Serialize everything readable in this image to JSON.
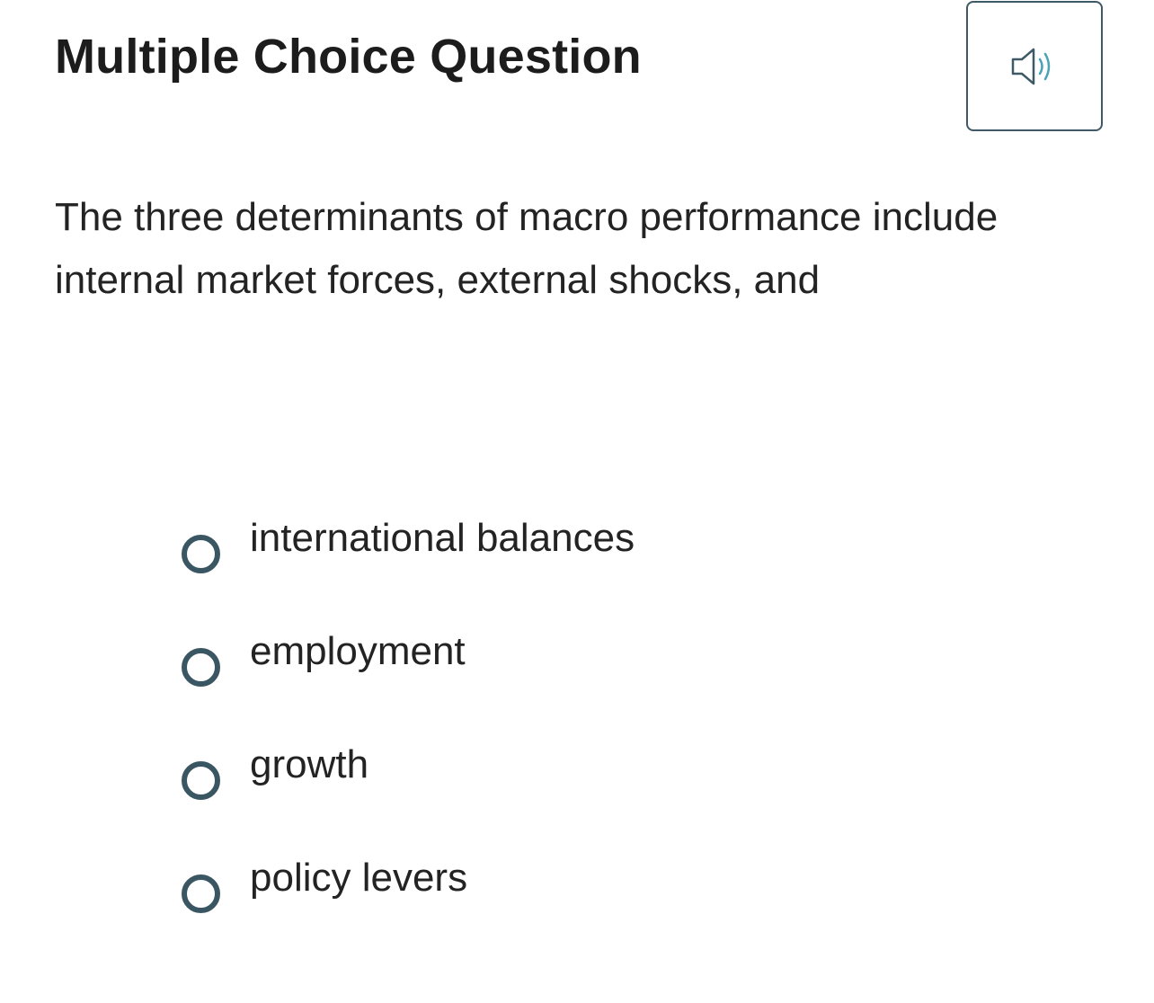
{
  "header": {
    "title": "Multiple Choice Question",
    "audio_icon": "speaker-icon"
  },
  "question": {
    "text": "The three determinants of macro performance include internal market forces, external shocks, and"
  },
  "options": [
    {
      "label": "international balances"
    },
    {
      "label": "employment"
    },
    {
      "label": "growth"
    },
    {
      "label": "policy levers"
    }
  ],
  "colors": {
    "radio_border": "#3a5663",
    "audio_border": "#3e5a66",
    "audio_waves": "#4aa3b5"
  }
}
